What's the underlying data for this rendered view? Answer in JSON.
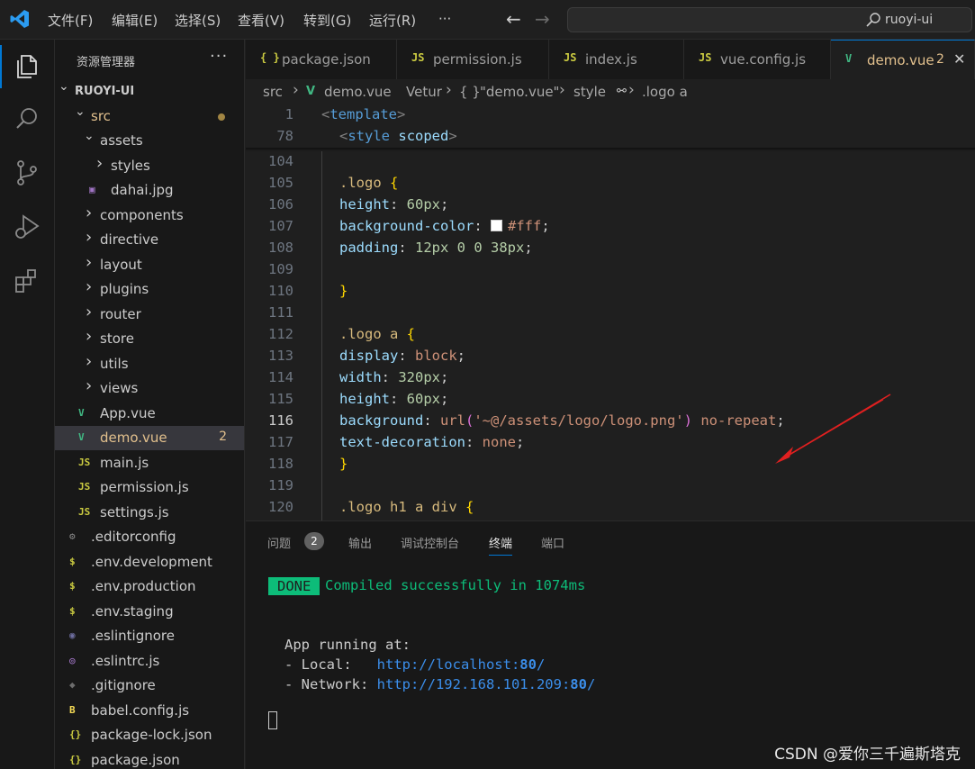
{
  "titlebar": {
    "menus": [
      "文件(F)",
      "编辑(E)",
      "选择(S)",
      "查看(V)",
      "转到(G)",
      "运行(R)",
      "···"
    ],
    "search_text": "ruoyi-ui",
    "back_icon": "arrow-left-icon",
    "forward_icon": "arrow-right-icon"
  },
  "activity_bar": {
    "items": [
      "explorer-icon",
      "search-icon",
      "source-control-icon",
      "run-debug-icon",
      "extensions-icon"
    ]
  },
  "sidebar": {
    "title": "资源管理器",
    "more": "···",
    "tree": [
      {
        "label": "RUOYI-UI",
        "type": "root",
        "depth": 0,
        "chevron": "⌄"
      },
      {
        "label": "src",
        "type": "folder-open",
        "depth": 1,
        "chevron": "⌄",
        "modified": true
      },
      {
        "label": "assets",
        "type": "folder-open",
        "depth": 2,
        "chevron": "⌄"
      },
      {
        "label": "styles",
        "type": "folder",
        "depth": 3,
        "chevron": "›"
      },
      {
        "label": "dahai.jpg",
        "type": "image",
        "depth": 3
      },
      {
        "label": "components",
        "type": "folder",
        "depth": 2,
        "chevron": "›"
      },
      {
        "label": "directive",
        "type": "folder",
        "depth": 2,
        "chevron": "›"
      },
      {
        "label": "layout",
        "type": "folder",
        "depth": 2,
        "chevron": "›"
      },
      {
        "label": "plugins",
        "type": "folder",
        "depth": 2,
        "chevron": "›"
      },
      {
        "label": "router",
        "type": "folder",
        "depth": 2,
        "chevron": "›"
      },
      {
        "label": "store",
        "type": "folder",
        "depth": 2,
        "chevron": "›"
      },
      {
        "label": "utils",
        "type": "folder",
        "depth": 2,
        "chevron": "›"
      },
      {
        "label": "views",
        "type": "folder",
        "depth": 2,
        "chevron": "›"
      },
      {
        "label": "App.vue",
        "type": "vue",
        "depth": 2
      },
      {
        "label": "demo.vue",
        "type": "vue",
        "depth": 2,
        "badge": "2",
        "selected": true
      },
      {
        "label": "main.js",
        "type": "js",
        "depth": 2
      },
      {
        "label": "permission.js",
        "type": "js",
        "depth": 2
      },
      {
        "label": "settings.js",
        "type": "js",
        "depth": 2
      },
      {
        "label": ".editorconfig",
        "type": "gear",
        "depth": 1
      },
      {
        "label": ".env.development",
        "type": "env",
        "depth": 1
      },
      {
        "label": ".env.production",
        "type": "env",
        "depth": 1
      },
      {
        "label": ".env.staging",
        "type": "env",
        "depth": 1
      },
      {
        "label": ".eslintignore",
        "type": "eslint",
        "depth": 1
      },
      {
        "label": ".eslintrc.js",
        "type": "eslintrc",
        "depth": 1
      },
      {
        "label": ".gitignore",
        "type": "git",
        "depth": 1
      },
      {
        "label": "babel.config.js",
        "type": "babel",
        "depth": 1
      },
      {
        "label": "package-lock.json",
        "type": "json",
        "depth": 1
      },
      {
        "label": "package.json",
        "type": "json",
        "depth": 1
      }
    ]
  },
  "tabs": [
    {
      "icon": "{ }",
      "label": "package.json"
    },
    {
      "icon": "JS",
      "label": "permission.js"
    },
    {
      "icon": "JS",
      "label": "index.js"
    },
    {
      "icon": "JS",
      "label": "vue.config.js"
    },
    {
      "icon": "V",
      "label": "demo.vue",
      "badge": "2",
      "close": "✕",
      "active": true
    }
  ],
  "breadcrumb": {
    "parts": [
      "src",
      "›",
      "demo.vue",
      "Vetur",
      "›",
      "{ }",
      "\"demo.vue\"",
      "›",
      "style",
      "›",
      ".logo a"
    ]
  },
  "editor": {
    "current_line": "116",
    "lines": [
      {
        "n": "1",
        "code": [
          [
            "t-angle",
            "<"
          ],
          [
            "t-tag",
            "template"
          ],
          [
            "t-angle",
            ">"
          ]
        ],
        "indent": 0
      },
      {
        "n": "78",
        "code": [
          [
            "t-angle",
            "<"
          ],
          [
            "t-tag",
            "style"
          ],
          [
            "",
            " "
          ],
          [
            "t-prop",
            "scoped"
          ],
          [
            "t-angle",
            ">"
          ]
        ],
        "indent": 1
      },
      {
        "n": "104",
        "code": [],
        "indent": 1
      },
      {
        "n": "105",
        "code": [
          [
            "t-sel",
            ".logo "
          ],
          [
            "t-brace",
            "{"
          ]
        ],
        "indent": 1
      },
      {
        "n": "106",
        "code": [
          [
            "t-prop",
            "height"
          ],
          [
            "",
            ": "
          ],
          [
            "t-num",
            "60px"
          ],
          [
            "",
            ";"
          ]
        ],
        "indent": 1
      },
      {
        "n": "107",
        "code": [
          [
            "t-prop",
            "background-color"
          ],
          [
            "",
            ": "
          ],
          [
            "swatch",
            ""
          ],
          [
            "t-val",
            "#fff"
          ],
          [
            "",
            ";"
          ]
        ],
        "indent": 1
      },
      {
        "n": "108",
        "code": [
          [
            "t-prop",
            "padding"
          ],
          [
            "",
            ": "
          ],
          [
            "t-num",
            "12px 0 0 38px"
          ],
          [
            "",
            ";"
          ]
        ],
        "indent": 1
      },
      {
        "n": "109",
        "code": [],
        "indent": 1
      },
      {
        "n": "110",
        "code": [
          [
            "t-brace",
            "}"
          ]
        ],
        "indent": 1
      },
      {
        "n": "111",
        "code": [],
        "indent": 1
      },
      {
        "n": "112",
        "code": [
          [
            "t-sel",
            ".logo a "
          ],
          [
            "t-brace",
            "{"
          ]
        ],
        "indent": 1
      },
      {
        "n": "113",
        "code": [
          [
            "t-prop",
            "display"
          ],
          [
            "",
            ": "
          ],
          [
            "t-val",
            "block"
          ],
          [
            "",
            ";"
          ]
        ],
        "indent": 1
      },
      {
        "n": "114",
        "code": [
          [
            "t-prop",
            "width"
          ],
          [
            "",
            ": "
          ],
          [
            "t-num",
            "320px"
          ],
          [
            "",
            ";"
          ]
        ],
        "indent": 1
      },
      {
        "n": "115",
        "code": [
          [
            "t-prop",
            "height"
          ],
          [
            "",
            ": "
          ],
          [
            "t-num",
            "60px"
          ],
          [
            "",
            ";"
          ]
        ],
        "indent": 1
      },
      {
        "n": "116",
        "code": [
          [
            "t-prop",
            "background"
          ],
          [
            "",
            ": "
          ],
          [
            "t-val",
            "url"
          ],
          [
            "t-paren",
            "("
          ],
          [
            "t-str",
            "'~@/assets/logo/logo.png'"
          ],
          [
            "t-paren",
            ")"
          ],
          [
            "",
            " "
          ],
          [
            "t-val",
            "no-repeat"
          ],
          [
            "",
            ";"
          ]
        ],
        "indent": 1
      },
      {
        "n": "117",
        "code": [
          [
            "t-prop",
            "text-decoration"
          ],
          [
            "",
            ": "
          ],
          [
            "t-val",
            "none"
          ],
          [
            "",
            ";"
          ]
        ],
        "indent": 1
      },
      {
        "n": "118",
        "code": [
          [
            "t-brace",
            "}"
          ]
        ],
        "indent": 1
      },
      {
        "n": "119",
        "code": [],
        "indent": 1
      },
      {
        "n": "120",
        "code": [
          [
            "t-sel",
            ".logo h1 a div "
          ],
          [
            "t-brace",
            "{"
          ]
        ],
        "indent": 1
      }
    ]
  },
  "panel": {
    "tabs": [
      "问题",
      "输出",
      "调试控制台",
      "终端",
      "端口"
    ],
    "problems_badge": "2",
    "active_tab": "终端",
    "terminal": {
      "done_label": "DONE",
      "done_message": "Compiled successfully in 1074ms",
      "app_running": "App running at:",
      "local_label": "- Local:   ",
      "local_url": "http://localhost:",
      "local_port": "80",
      "network_label": "- Network: ",
      "network_url": "http://192.168.101.209:",
      "network_port": "80",
      "url_suffix": "/"
    }
  },
  "watermark": "CSDN @爱你三千遍斯塔克",
  "colors": {
    "accent": "#0078d4",
    "vue_green": "#41b883",
    "js_yellow": "#cbcb41",
    "done_green": "#0dbc79",
    "annotation_red": "#e02020"
  }
}
